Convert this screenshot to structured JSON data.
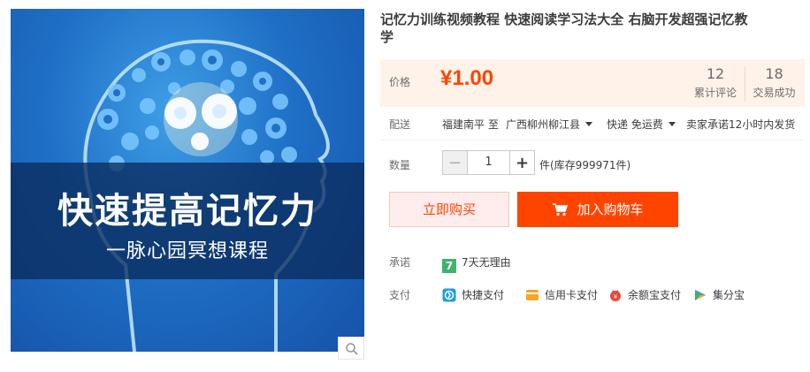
{
  "product": {
    "title_line1": "记忆力训练视频教程 快速阅读学习法大全 右脑开发超强记忆教",
    "title_line2": "学",
    "image": {
      "headline": "快速提高记忆力",
      "subline": "一脉心园冥想课程"
    }
  },
  "price": {
    "label": "价格",
    "value": "¥1.00",
    "reviews_count": "12",
    "reviews_label": "累计评论",
    "sales_count": "18",
    "sales_label": "交易成功"
  },
  "delivery": {
    "label": "配送",
    "from": "福建南平",
    "to_word": "至",
    "destination": "广西柳州柳江县",
    "shipping": "快递 免运费",
    "promise": "卖家承诺12小时内发货"
  },
  "quantity": {
    "label": "数量",
    "value": "1",
    "minus": "−",
    "plus": "+",
    "stock": "件(库存999971件)"
  },
  "actions": {
    "buy_now": "立即购买",
    "add_to_cart": "加入购物车"
  },
  "guarantee": {
    "label": "承诺",
    "item": "7天无理由",
    "badge": "7"
  },
  "payment": {
    "label": "支付",
    "methods": [
      "快捷支付",
      "信用卡支付",
      "余额宝支付",
      "集分宝"
    ]
  },
  "colors": {
    "accent": "#ff4400",
    "price_bg": "#fff2e8"
  }
}
